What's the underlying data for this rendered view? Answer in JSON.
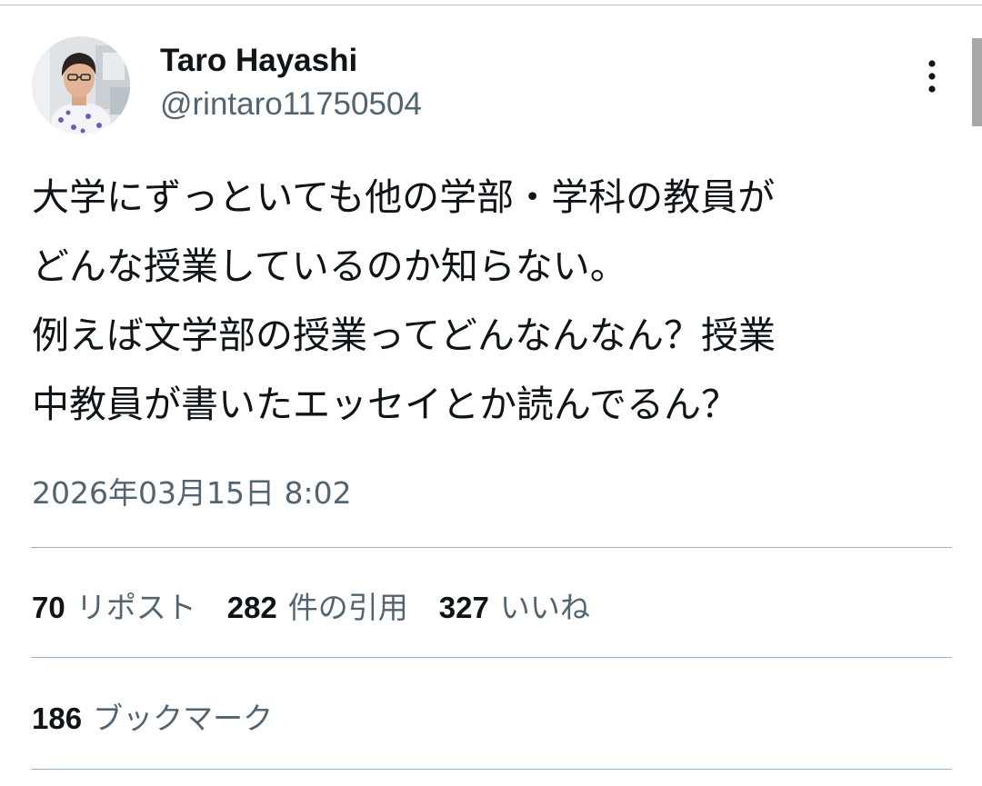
{
  "author": {
    "display_name": "Taro Hayashi",
    "handle": "@rintaro11750504"
  },
  "tweet": {
    "lines": [
      "大学にずっといても他の学部・学科の教員が",
      "どんな授業しているのか知らない。",
      "例えば文学部の授業ってどんなんなん？授業",
      "中教員が書いたエッセイとか読んでるん？"
    ],
    "timestamp": "2026年03月15日 8:02"
  },
  "stats": {
    "reposts": {
      "count": "70",
      "label": "リポスト"
    },
    "quotes": {
      "count": "282",
      "label": "件の引用"
    },
    "likes": {
      "count": "327",
      "label": "いいね"
    },
    "bookmarks": {
      "count": "186",
      "label": "ブックマーク"
    }
  },
  "icons": {
    "more": "more-vertical-icon",
    "avatar": "profile-photo"
  },
  "colors": {
    "text_primary": "#0f1419",
    "text_secondary": "#536471",
    "divider": "#9db3cc"
  }
}
